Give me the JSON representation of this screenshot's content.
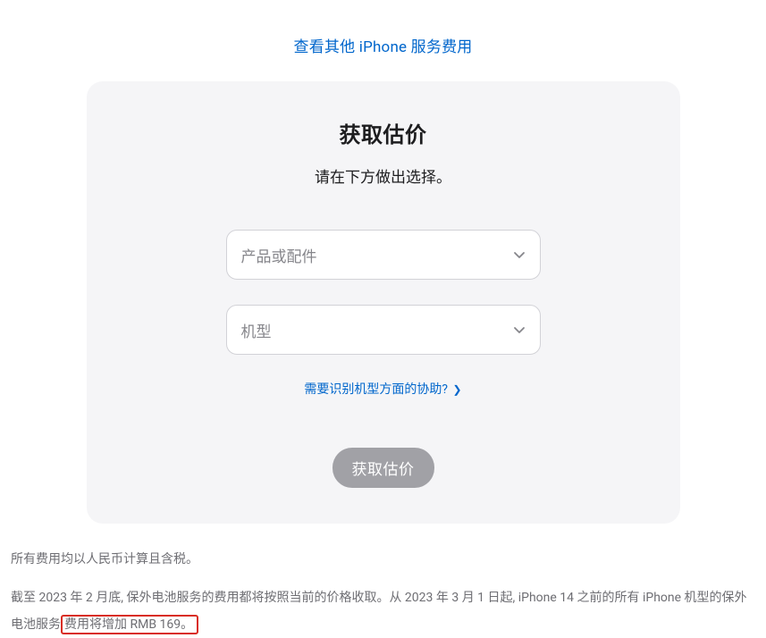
{
  "top_link": {
    "label": "查看其他 iPhone 服务费用"
  },
  "card": {
    "title": "获取估价",
    "subtitle": "请在下方做出选择。",
    "select_product_placeholder": "产品或配件",
    "select_model_placeholder": "机型",
    "help_link_label": "需要识别机型方面的协助?",
    "submit_label": "获取估价"
  },
  "notes": {
    "line1": "所有费用均以人民币计算且含税。",
    "line2_a": "截至 2023 年 2 月底, 保外电池服务的费用都将按照当前的价格收取。从 2023 年 3 月 1 日起, iPhone 14 之前的所有 iPhone 机型的保外电池服务",
    "line2_highlight": "费用将增加 RMB 169。"
  }
}
